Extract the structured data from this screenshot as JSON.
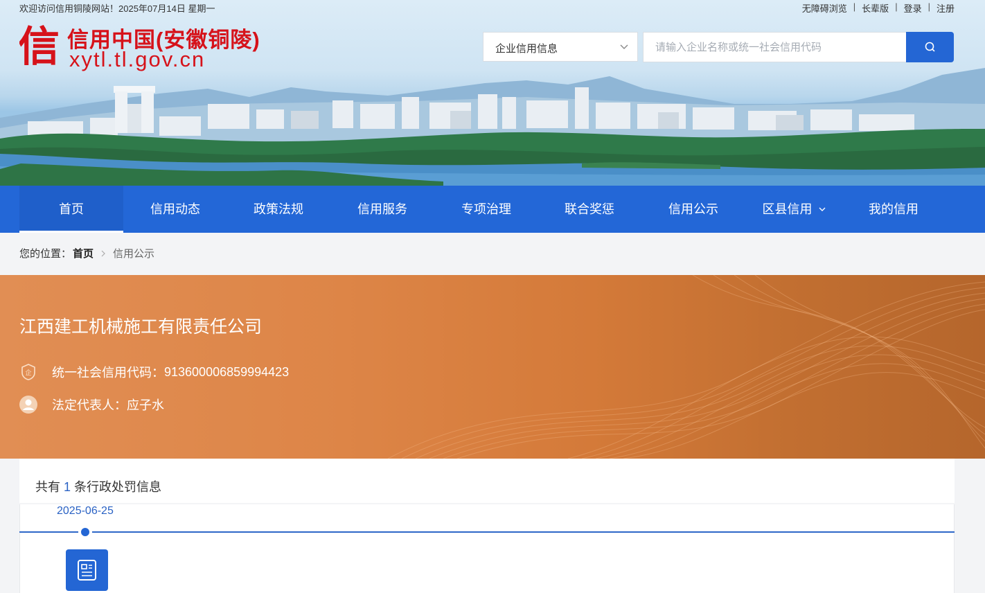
{
  "topbar": {
    "welcome": "欢迎访问信用铜陵网站！2025年07月14日 星期一",
    "links": [
      "无障碍浏览",
      "长辈版",
      "登录",
      "注册"
    ]
  },
  "logo": {
    "mark_char": "信",
    "title": "信用中国(安徽铜陵)",
    "url": "xytl.tl.gov.cn",
    "color": "#d6121a"
  },
  "search": {
    "type_label": "企业信用信息",
    "placeholder": "请输入企业名称或统一社会信用代码",
    "button_icon": "search-icon",
    "button_color": "#2466d4"
  },
  "nav": {
    "items": [
      "首页",
      "信用动态",
      "政策法规",
      "信用服务",
      "专项治理",
      "联合奖惩",
      "信用公示",
      "区县信用",
      "我的信用"
    ],
    "active": "首页",
    "dropdown_item": "区县信用",
    "color": "#2367d7"
  },
  "breadcrumb": {
    "prefix": "您的位置：",
    "home": "首页",
    "current": "信用公示"
  },
  "company": {
    "name": "江西建工机械施工有限责任公司",
    "code_label": "统一社会信用代码：",
    "code": "913600006859994423",
    "rep_label": "法定代表人：",
    "rep": "应子水"
  },
  "records": {
    "summary_pre": "共有",
    "count": "1",
    "summary_post": "条行政处罚信息",
    "timeline": [
      {
        "date": "2025-06-25",
        "icon": "document-icon"
      }
    ]
  }
}
